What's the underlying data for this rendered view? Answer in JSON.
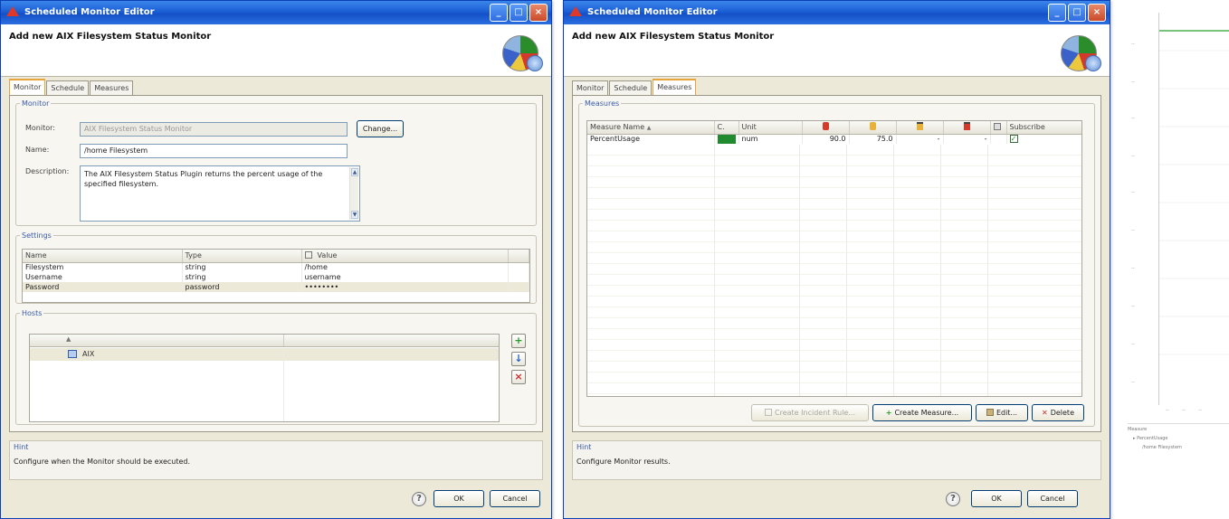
{
  "window1": {
    "title": "Scheduled Monitor Editor",
    "header_title": "Add new AIX Filesystem Status Monitor",
    "tabs": [
      "Monitor",
      "Schedule",
      "Measures"
    ],
    "monitor_group": {
      "legend": "Monitor",
      "monitor_label": "Monitor:",
      "monitor_value": "AIX Filesystem Status Monitor",
      "change_button": "Change...",
      "name_label": "Name:",
      "name_value": "/home Filesystem",
      "description_label": "Description:",
      "description_value": "The AIX Filesystem Status Plugin returns the percent usage of the specified filesystem."
    },
    "settings_group": {
      "legend": "Settings",
      "columns": [
        "Name",
        "Type",
        "Value"
      ],
      "rows": [
        [
          "Filesystem",
          "string",
          "/home"
        ],
        [
          "Username",
          "string",
          "username"
        ],
        [
          "Password",
          "password",
          "••••••••"
        ]
      ]
    },
    "hosts_group": {
      "legend": "Hosts",
      "items": [
        "AIX"
      ]
    },
    "hint": {
      "label": "Hint",
      "text": "Configure when the Monitor should be executed."
    },
    "ok": "OK",
    "cancel": "Cancel"
  },
  "window2": {
    "title": "Scheduled Monitor Editor",
    "header_title": "Add new AIX Filesystem Status Monitor",
    "tabs": [
      "Monitor",
      "Schedule",
      "Measures"
    ],
    "measures_group": {
      "legend": "Measures",
      "columns": [
        "Measure Name",
        "C.",
        "Unit",
        "",
        "",
        "",
        "",
        "",
        "Subscribe"
      ],
      "row": {
        "name": "PercentUsage",
        "color": "#1f8a2e",
        "unit": "num",
        "v1": "90.0",
        "v2": "75.0",
        "v3": "-",
        "v4": "-"
      }
    },
    "buttons": {
      "create_incident": "Create Incident Rule...",
      "create_measure": "Create Measure...",
      "edit": "Edit...",
      "delete": "Delete"
    },
    "hint": {
      "label": "Hint",
      "text": "Configure Monitor results."
    },
    "ok": "OK",
    "cancel": "Cancel"
  },
  "colors": {
    "accent": "#1c5fd6",
    "series": "#4caf50"
  },
  "chart_data": {
    "type": "line",
    "series": [
      {
        "values": [
          1,
          1,
          1,
          1
        ]
      }
    ],
    "legend_title": "Measure",
    "legend_items": [
      "PercentUsage",
      "/home Filesystem"
    ]
  }
}
